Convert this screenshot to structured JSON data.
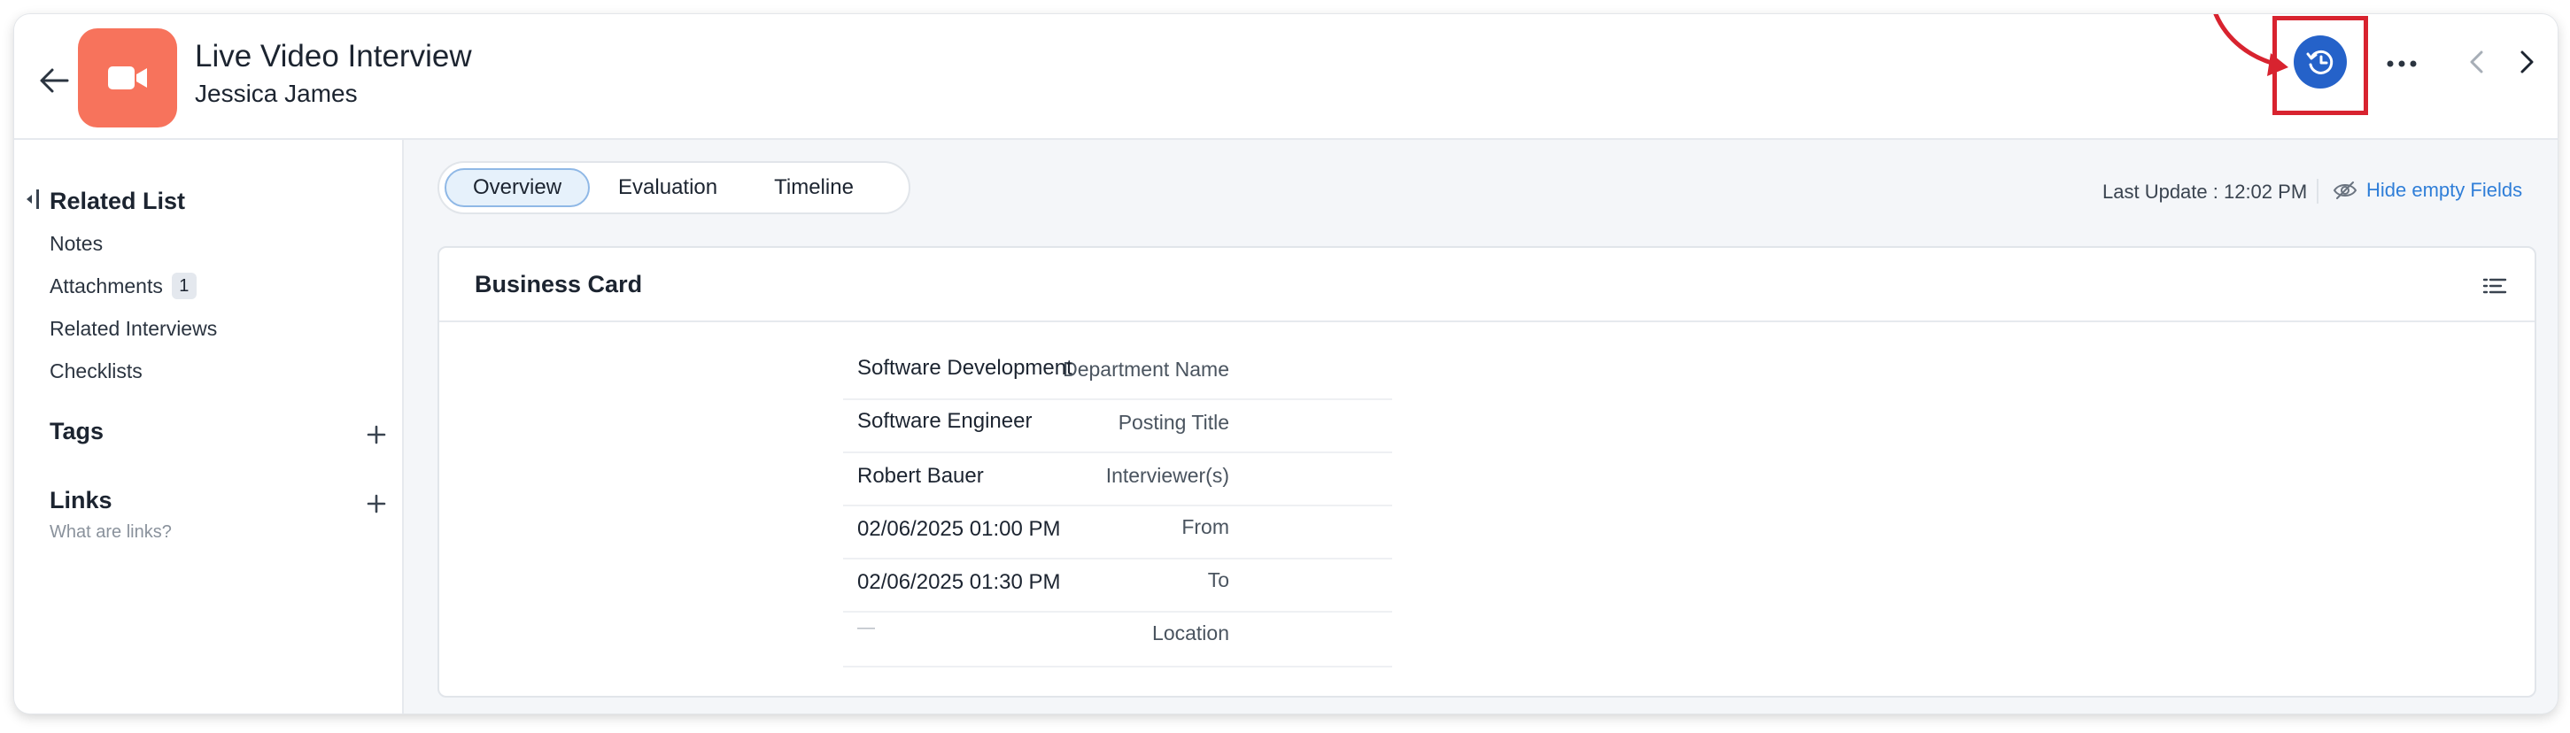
{
  "header": {
    "title": "Live Video Interview",
    "subtitle": "Jessica James",
    "back_icon": "arrow-left-icon",
    "avatar_icon": "video-camera-icon",
    "history_icon": "history-clock-icon",
    "more_icon": "more-horizontal-icon",
    "prev_icon": "chevron-left-icon",
    "next_icon": "chevron-right-icon"
  },
  "sidebar": {
    "related_list_heading": "Related List",
    "items": [
      {
        "label": "Notes"
      },
      {
        "label": "Attachments",
        "badge": "1"
      },
      {
        "label": "Related Interviews"
      },
      {
        "label": "Checklists"
      }
    ],
    "tags_heading": "Tags",
    "links_heading": "Links",
    "links_hint": "What are links?"
  },
  "tabs": [
    {
      "label": "Overview",
      "active": true
    },
    {
      "label": "Evaluation",
      "active": false
    },
    {
      "label": "Timeline",
      "active": false
    }
  ],
  "toolbar": {
    "last_update": "Last Update : 12:02 PM",
    "hide_empty": "Hide empty Fields"
  },
  "card": {
    "title": "Business Card",
    "fields": [
      {
        "label": "Department Name",
        "value": "Software Development"
      },
      {
        "label": "Posting Title",
        "value": "Software Engineer"
      },
      {
        "label": "Interviewer(s)",
        "value": "Robert Bauer"
      },
      {
        "label": "From",
        "value": "02/06/2025 01:00 PM"
      },
      {
        "label": "To",
        "value": "02/06/2025 01:30 PM"
      },
      {
        "label": "Location",
        "value": "—"
      }
    ]
  },
  "colors": {
    "accent": "#2562c9",
    "avatar": "#f7735c",
    "highlight": "#d8232f",
    "link": "#2f7ed8"
  }
}
